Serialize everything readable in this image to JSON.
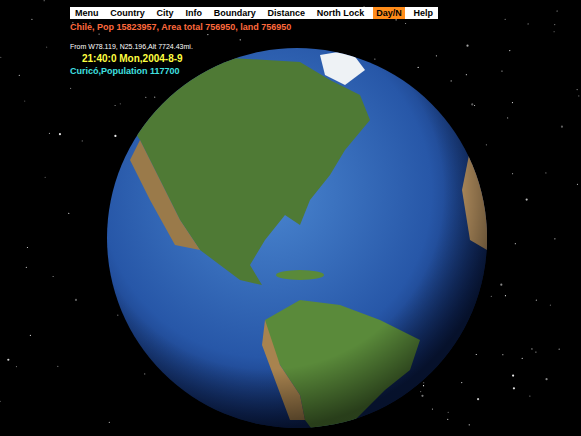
{
  "menu_bar": {
    "items": [
      {
        "label": "Menu",
        "selected": false
      },
      {
        "label": "Country",
        "selected": false
      },
      {
        "label": "City",
        "selected": false
      },
      {
        "label": "Info",
        "selected": false
      },
      {
        "label": "Boundary",
        "selected": false
      },
      {
        "label": "Distance",
        "selected": false
      },
      {
        "label": "North Lock",
        "selected": false
      },
      {
        "label": "Day/N",
        "selected": true
      },
      {
        "label": "Help",
        "selected": false
      }
    ]
  },
  "country_info": "Chile, Pop  15823957, Area total 756950, land 756950",
  "view_position": "From W78.119, N25.196,Alt 7724.43mi.",
  "clock": "21:40:0 Mon,2004-8-9",
  "city_info": "Curicó,Population  117700"
}
